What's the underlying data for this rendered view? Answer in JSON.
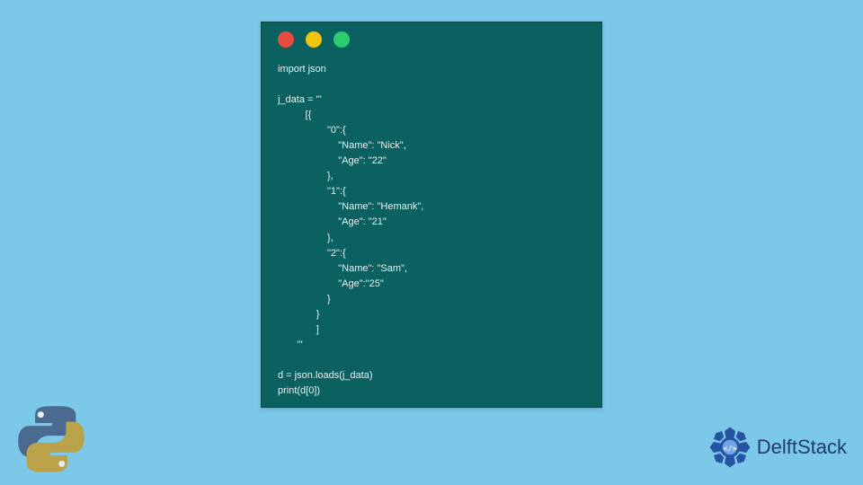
{
  "window": {
    "traffic_lights": [
      "red",
      "yellow",
      "green"
    ]
  },
  "code": {
    "lines": [
      "import json",
      "",
      "j_data = '''",
      "          [{",
      "                  \"0\":{",
      "                      \"Name\": \"Nick\",",
      "                      \"Age\": \"22\"",
      "                  },",
      "                  \"1\":{",
      "                      \"Name\": \"Hemank\",",
      "                      \"Age\": \"21\"",
      "                  },",
      "                  \"2\":{",
      "                      \"Name\": \"Sam\",",
      "                      \"Age\":\"25\"",
      "                  }",
      "              }",
      "              ]",
      "       '''",
      "",
      "d = json.loads(j_data)",
      "print(d[0])"
    ]
  },
  "branding": {
    "name": "DelftStack"
  },
  "logos": {
    "bottom_left": "python-logo",
    "bottom_right": "delftstack-logo"
  },
  "colors": {
    "page_bg": "#7BC8E8",
    "code_bg": "#0B6160",
    "code_fg": "#E6F3F2",
    "brand_text": "#1F3A73"
  }
}
